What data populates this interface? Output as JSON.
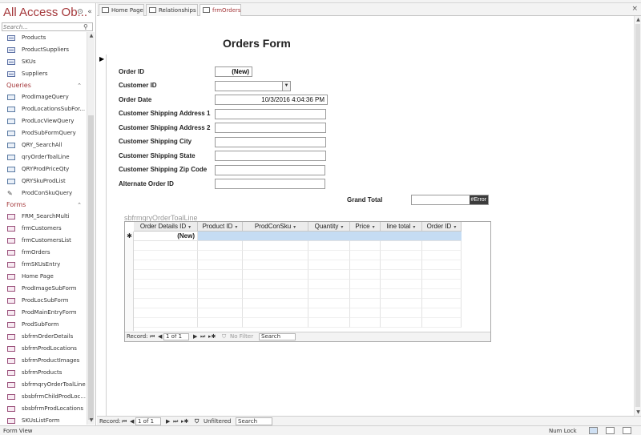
{
  "nav": {
    "title": "All Access Ob...",
    "search_placeholder": "Search...",
    "tables": [
      {
        "label": "Products"
      },
      {
        "label": "ProductSuppliers"
      },
      {
        "label": "SKUs"
      },
      {
        "label": "Suppliers"
      }
    ],
    "queries_header": "Queries",
    "queries": [
      {
        "label": "ProdImageQuery"
      },
      {
        "label": "ProdLocationsSubFor..."
      },
      {
        "label": "ProdLocViewQuery"
      },
      {
        "label": "ProdSubFormQuery"
      },
      {
        "label": "QRY_SearchAll"
      },
      {
        "label": "qryOrderToalLine"
      },
      {
        "label": "QRYProdPriceQty"
      },
      {
        "label": "QRYSkuProdList"
      },
      {
        "label": "ProdConSkuQuery"
      }
    ],
    "forms_header": "Forms",
    "forms": [
      {
        "label": "FRM_SearchMulti"
      },
      {
        "label": "frmCustomers"
      },
      {
        "label": "frmCustomersList"
      },
      {
        "label": "frmOrders"
      },
      {
        "label": "frmSKUsEntry"
      },
      {
        "label": "Home Page"
      },
      {
        "label": "ProdImageSubForm"
      },
      {
        "label": "ProdLocSubForm"
      },
      {
        "label": "ProdMainEntryForm"
      },
      {
        "label": "ProdSubForm"
      },
      {
        "label": "sbfrmOrderDetails"
      },
      {
        "label": "sbfrmProdLocations"
      },
      {
        "label": "sbfrmProductImages"
      },
      {
        "label": "sbfrmProducts"
      },
      {
        "label": "sbfrmqryOrderToalLine"
      },
      {
        "label": "sbsbfrmChildProdLoc..."
      },
      {
        "label": "sbsbfrmProdLocations"
      },
      {
        "label": "SKUsListForm"
      }
    ]
  },
  "tabs": [
    {
      "label": "Home Page"
    },
    {
      "label": "Relationships"
    },
    {
      "label": "frmOrders"
    }
  ],
  "form": {
    "title": "Orders Form",
    "fields": {
      "order_id": {
        "label": "Order ID",
        "value": "(New)"
      },
      "customer_id": {
        "label": "Customer ID",
        "value": ""
      },
      "order_date": {
        "label": "Order Date",
        "value": "10/3/2016 4:04:36 PM"
      },
      "addr1": {
        "label": "Customer Shipping Address 1",
        "value": ""
      },
      "addr2": {
        "label": "Customer Shipping Address 2",
        "value": ""
      },
      "city": {
        "label": "Customer Shipping City",
        "value": ""
      },
      "state": {
        "label": "Customer Shipping State",
        "value": ""
      },
      "zip": {
        "label": "Customer Shipping Zip Code",
        "value": ""
      },
      "alt_order": {
        "label": "Alternate Order ID",
        "value": ""
      },
      "grand_total": {
        "label": "Grand Total",
        "value": "#Error"
      }
    }
  },
  "subform": {
    "label": "sbfrmqryOrderToalLine",
    "columns": [
      "Order Details ID",
      "Product ID",
      "ProdConSku",
      "Quantity",
      "Price",
      "line total",
      "Order ID"
    ],
    "new_row_marker": "✱",
    "new_row_value": "(New)",
    "nav": {
      "record_label": "Record:",
      "record_value": "1 of 1",
      "filter": "No Filter",
      "search": "Search"
    }
  },
  "main_nav": {
    "record_label": "Record:",
    "record_value": "1 of 1",
    "filter": "Unfiltered",
    "search": "Search"
  },
  "status": {
    "left": "Form View",
    "num_lock": "Num Lock"
  },
  "colors": {
    "accent": "#a4373a",
    "selected_row": "#c5dcf3"
  }
}
